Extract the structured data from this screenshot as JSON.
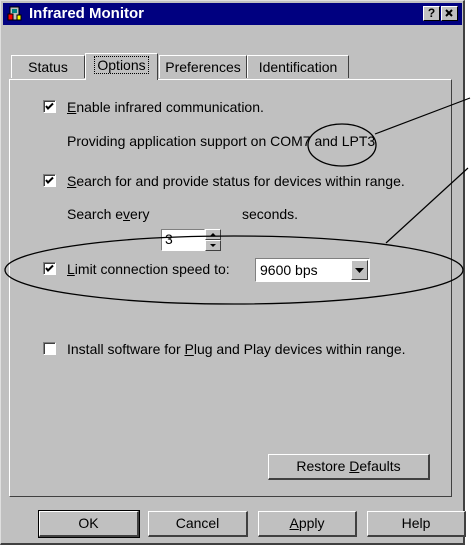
{
  "window": {
    "title": "Infrared Monitor",
    "help_label": "?",
    "close_label": "✕"
  },
  "tabs": [
    {
      "label": "Status",
      "active": false
    },
    {
      "label": "Options",
      "active": true
    },
    {
      "label": "Preferences",
      "active": false
    },
    {
      "label": "Identification",
      "active": false
    }
  ],
  "options": {
    "enable_ir": {
      "pre": "",
      "u": "E",
      "post": "nable infrared communication.",
      "checked": true
    },
    "support_text": "Providing application support on COM7 and LPT3",
    "search": {
      "pre": "",
      "u": "S",
      "post": "earch for and provide status for devices within range.",
      "checked": true
    },
    "search_every": {
      "pre": "Search e",
      "u": "v",
      "post": "ery"
    },
    "search_interval": "3",
    "seconds_label": "seconds.",
    "limit_speed": {
      "pre": "",
      "u": "L",
      "post": "imit connection speed to:",
      "checked": true
    },
    "speed_value": "9600 bps",
    "install": {
      "pre": "Install software for ",
      "u": "P",
      "post": "lug and Play devices within range.",
      "checked": false
    }
  },
  "buttons": {
    "restore": {
      "pre": "Restore ",
      "u": "D",
      "post": "efaults"
    },
    "ok": "OK",
    "cancel": "Cancel",
    "apply": {
      "pre": "",
      "u": "A",
      "post": "pply"
    },
    "help": "Help"
  }
}
